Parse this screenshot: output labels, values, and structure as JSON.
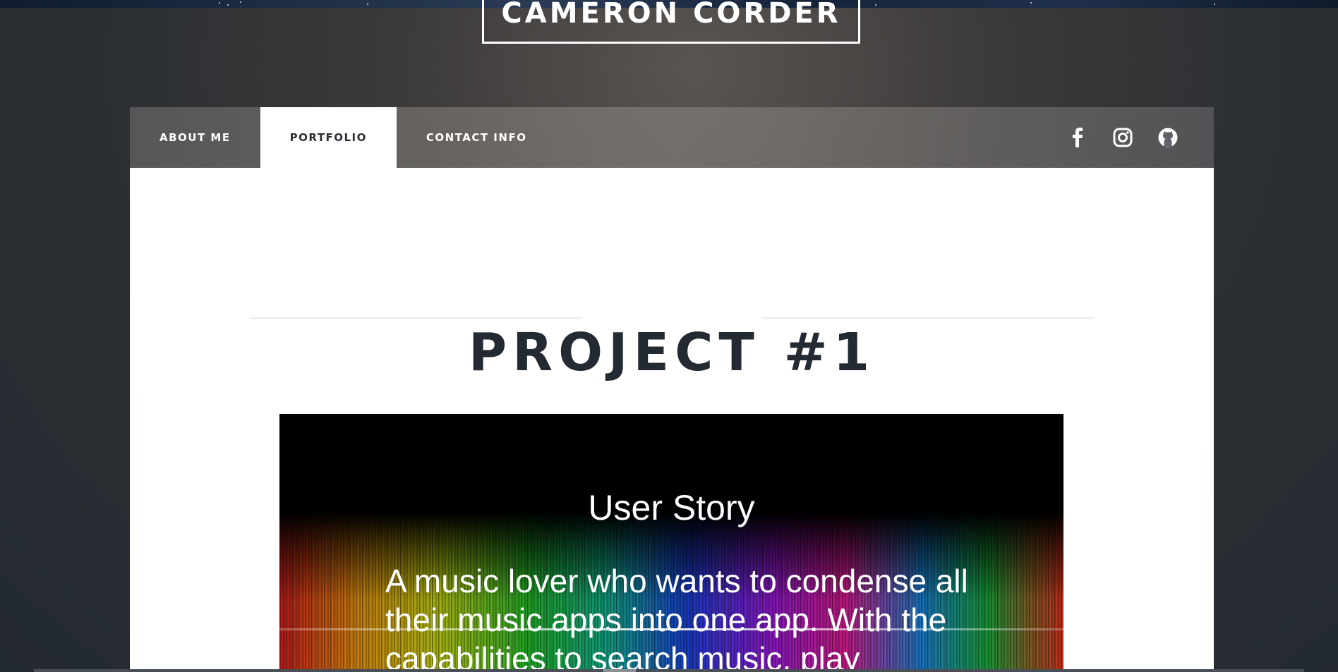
{
  "header": {
    "brand": "CAMERON CORDER"
  },
  "nav": {
    "tabs": [
      {
        "label": "ABOUT ME",
        "active": false
      },
      {
        "label": "PORTFOLIO",
        "active": true
      },
      {
        "label": "CONTACT INFO",
        "active": false
      }
    ],
    "social": [
      {
        "icon": "facebook-icon"
      },
      {
        "icon": "instagram-icon"
      },
      {
        "icon": "github-icon"
      }
    ]
  },
  "main": {
    "project_title": "PROJECT #1",
    "image": {
      "heading": "User Story",
      "text": "A music lover who wants to condense all their music apps into one app. With the capabilities to search music, play"
    }
  },
  "colors": {
    "background": "#2b2f33",
    "active_tab_bg": "#ffffff",
    "title_text": "#232a32",
    "white": "#ffffff"
  }
}
